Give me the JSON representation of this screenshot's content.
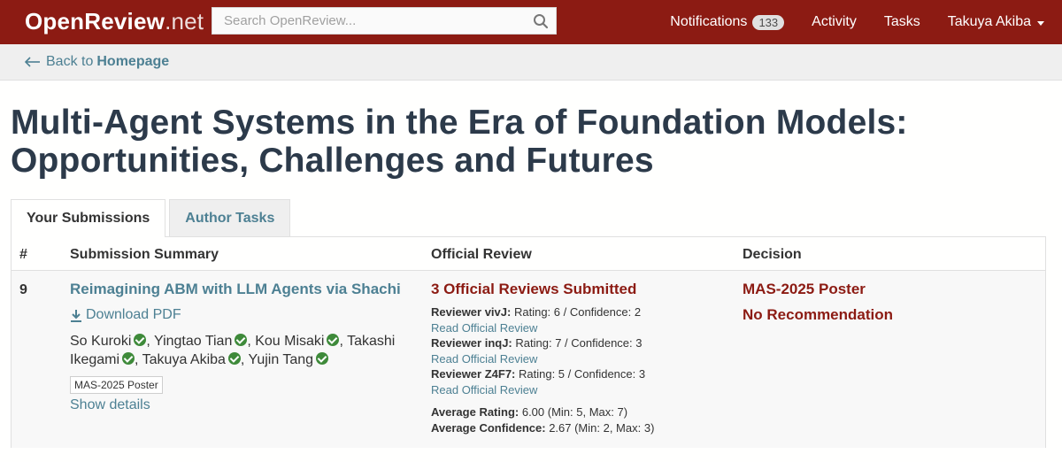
{
  "navbar": {
    "brand_main": "OpenReview",
    "brand_suffix": ".net",
    "search_placeholder": "Search OpenReview...",
    "notifications_label": "Notifications",
    "notifications_count": "133",
    "activity_label": "Activity",
    "tasks_label": "Tasks",
    "user_label": "Takuya Akiba"
  },
  "backbar": {
    "back_text": "Back to",
    "back_target": "Homepage"
  },
  "page": {
    "title": "Multi-Agent Systems in the Era of Foundation Models: Opportunities, Challenges and Futures"
  },
  "tabs": [
    {
      "label": "Your Submissions",
      "active": true
    },
    {
      "label": "Author Tasks",
      "active": false
    }
  ],
  "table": {
    "headers": {
      "num": "#",
      "summary": "Submission Summary",
      "review": "Official Review",
      "decision": "Decision"
    },
    "rows": [
      {
        "num": "9",
        "title": "Reimagining ABM with LLM Agents via Shachi",
        "download_label": "Download PDF",
        "authors": [
          "So Kuroki",
          "Yingtao Tian",
          "Kou Misaki",
          "Takashi Ikegami",
          "Takuya Akiba",
          "Yujin Tang"
        ],
        "venue_tag": "MAS-2025 Poster",
        "show_details": "Show details",
        "reviews_summary": "3 Official Reviews Submitted",
        "reviews": [
          {
            "reviewer": "Reviewer vivJ:",
            "scores": "Rating: 6 / Confidence: 2",
            "link": "Read Official Review"
          },
          {
            "reviewer": "Reviewer inqJ:",
            "scores": "Rating: 7 / Confidence: 3",
            "link": "Read Official Review"
          },
          {
            "reviewer": "Reviewer Z4F7:",
            "scores": "Rating: 5 / Confidence: 3",
            "link": "Read Official Review"
          }
        ],
        "avg_rating_label": "Average Rating:",
        "avg_rating_value": "6.00 (Min: 5, Max: 7)",
        "avg_conf_label": "Average Confidence:",
        "avg_conf_value": "2.67 (Min: 2, Max: 3)",
        "decision": "MAS-2025 Poster",
        "recommendation": "No Recommendation"
      }
    ]
  },
  "colors": {
    "brand": "#8c1b13",
    "link": "#4d8093",
    "verified": "#3e8a3a"
  }
}
